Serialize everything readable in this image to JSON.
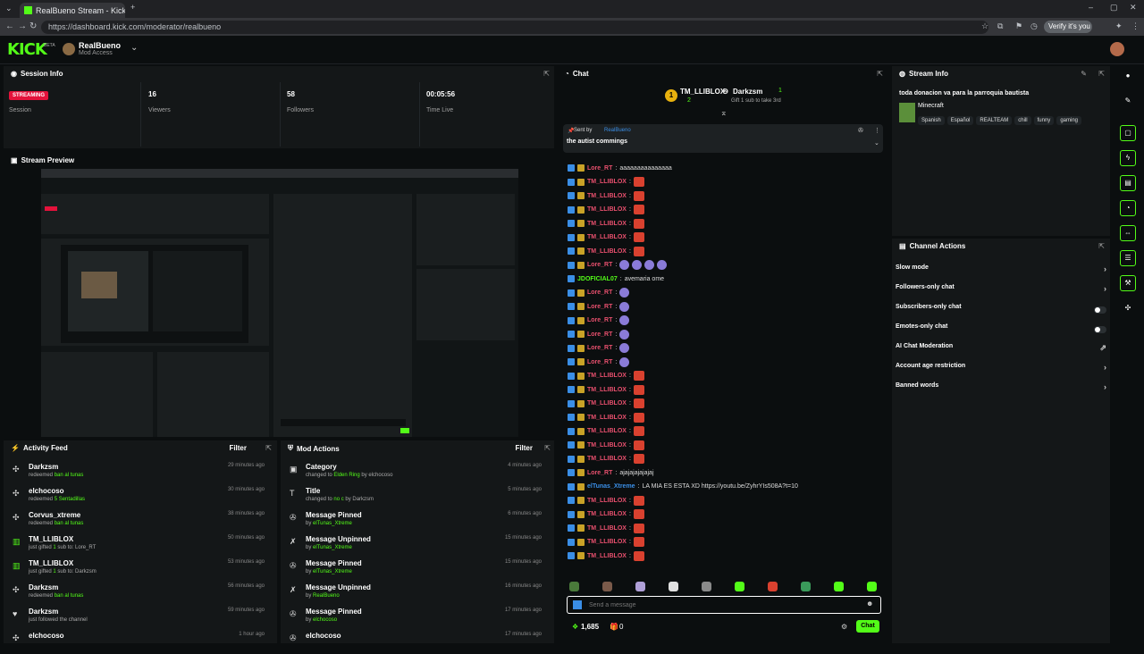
{
  "browser": {
    "tab_title": "RealBueno Stream - Kick Dashbo",
    "url": "https://dashboard.kick.com/moderator/realbueno",
    "verify_label": "Verify it's you"
  },
  "header": {
    "logo": "KICK",
    "logo_beta": "BETA",
    "channel_name": "RealBueno",
    "channel_role": "Mod Access"
  },
  "session_info": {
    "title": "Session Info",
    "status_badge": "STREAMING",
    "status_label": "Session",
    "viewers_value": "16",
    "viewers_label": "Viewers",
    "followers_value": "58",
    "followers_label": "Followers",
    "time_value": "00:05:56",
    "time_label": "Time Live"
  },
  "stream_preview": {
    "title": "Stream Preview"
  },
  "activity_feed": {
    "title": "Activity Feed",
    "filter": "Filter",
    "items": [
      {
        "name": "Darkzsm",
        "pre": "redeemed ",
        "hl": "ban al tunas",
        "post": "",
        "time": "29 minutes ago",
        "icon": "redeem"
      },
      {
        "name": "elchocoso",
        "pre": "redeemed ",
        "hl": "5 Sentadillas",
        "post": "",
        "time": "30 minutes ago",
        "icon": "redeem"
      },
      {
        "name": "Corvus_xtreme",
        "pre": "redeemed ",
        "hl": "ban al tunas",
        "post": "",
        "time": "38 minutes ago",
        "icon": "redeem"
      },
      {
        "name": "TM_LLIBLOX",
        "pre": "just gifted ",
        "hl": "1",
        "post": " sub to: Lore_RT",
        "time": "50 minutes ago",
        "icon": "gift"
      },
      {
        "name": "TM_LLIBLOX",
        "pre": "just gifted ",
        "hl": "1",
        "post": " sub to: Darkzsm",
        "time": "53 minutes ago",
        "icon": "gift"
      },
      {
        "name": "Darkzsm",
        "pre": "redeemed ",
        "hl": "ban al tunas",
        "post": "",
        "time": "56 minutes ago",
        "icon": "redeem"
      },
      {
        "name": "Darkzsm",
        "pre": "just followed the channel",
        "hl": "",
        "post": "",
        "time": "59 minutes ago",
        "icon": "heart"
      },
      {
        "name": "elchocoso",
        "pre": "",
        "hl": "",
        "post": "",
        "time": "1 hour ago",
        "icon": "redeem"
      }
    ]
  },
  "mod_actions": {
    "title": "Mod Actions",
    "filter": "Filter",
    "items": [
      {
        "name": "Category",
        "pre": "changed to ",
        "hl": "Elden Ring",
        "post": " by elchocoso",
        "time": "4 minutes ago",
        "icon": "category"
      },
      {
        "name": "Title",
        "pre": "changed to ",
        "hl": "no c",
        "post": " by Darkzsm",
        "time": "5 minutes ago",
        "icon": "title"
      },
      {
        "name": "Message Pinned",
        "pre": "by ",
        "hl": "elTunas_Xtreme",
        "post": "",
        "time": "6 minutes ago",
        "icon": "pin"
      },
      {
        "name": "Message Unpinned",
        "pre": "by ",
        "hl": "elTunas_Xtreme",
        "post": "",
        "time": "15 minutes ago",
        "icon": "unpin"
      },
      {
        "name": "Message Pinned",
        "pre": "by ",
        "hl": "elTunas_Xtreme",
        "post": "",
        "time": "15 minutes ago",
        "icon": "pin"
      },
      {
        "name": "Message Unpinned",
        "pre": "by ",
        "hl": "RealBueno",
        "post": "",
        "time": "16 minutes ago",
        "icon": "unpin"
      },
      {
        "name": "Message Pinned",
        "pre": "by ",
        "hl": "elchocoso",
        "post": "",
        "time": "17 minutes ago",
        "icon": "pin"
      },
      {
        "name": "elchocoso",
        "pre": "",
        "hl": "",
        "post": "",
        "time": "17 minutes ago",
        "icon": "pin"
      }
    ]
  },
  "chat": {
    "title": "Chat",
    "gift_leader_name": "TM_LLIBLOX",
    "gift_leader_count": "2",
    "gift_second_name": "Darkzsm",
    "gift_second_count": "1",
    "gift_hint": "Gift 1 sub to take 3rd",
    "pinned_sent_by": "Sent by",
    "pinned_author": "RealBueno",
    "pinned_text": "the autist commings",
    "messages": [
      {
        "user": "Lore_RT",
        "color": "#e8506e",
        "text": "aaaaaaaaaaaaaaa",
        "emotes": 0,
        "type": "none"
      },
      {
        "user": "TM_LLIBLOX",
        "color": "#e8506e",
        "text": "",
        "emotes": 1,
        "type": "red"
      },
      {
        "user": "TM_LLIBLOX",
        "color": "#e8506e",
        "text": "",
        "emotes": 1,
        "type": "red"
      },
      {
        "user": "TM_LLIBLOX",
        "color": "#e8506e",
        "text": "",
        "emotes": 1,
        "type": "red"
      },
      {
        "user": "TM_LLIBLOX",
        "color": "#e8506e",
        "text": "",
        "emotes": 1,
        "type": "red"
      },
      {
        "user": "TM_LLIBLOX",
        "color": "#e8506e",
        "text": "",
        "emotes": 1,
        "type": "red"
      },
      {
        "user": "TM_LLIBLOX",
        "color": "#e8506e",
        "text": "",
        "emotes": 1,
        "type": "red"
      },
      {
        "user": "Lore_RT",
        "color": "#e8506e",
        "text": "",
        "emotes": 4,
        "type": "purple"
      },
      {
        "user": "JDOFICIAL07",
        "color": "#53fc18",
        "text": "avemaria ome",
        "emotes": 0,
        "type": "none"
      },
      {
        "user": "Lore_RT",
        "color": "#e8506e",
        "text": "",
        "emotes": 1,
        "type": "purple"
      },
      {
        "user": "Lore_RT",
        "color": "#e8506e",
        "text": "",
        "emotes": 1,
        "type": "purple"
      },
      {
        "user": "Lore_RT",
        "color": "#e8506e",
        "text": "",
        "emotes": 1,
        "type": "purple"
      },
      {
        "user": "Lore_RT",
        "color": "#e8506e",
        "text": "",
        "emotes": 1,
        "type": "purple"
      },
      {
        "user": "Lore_RT",
        "color": "#e8506e",
        "text": "",
        "emotes": 1,
        "type": "purple"
      },
      {
        "user": "Lore_RT",
        "color": "#e8506e",
        "text": "",
        "emotes": 1,
        "type": "purple"
      },
      {
        "user": "TM_LLIBLOX",
        "color": "#e8506e",
        "text": "",
        "emotes": 1,
        "type": "red"
      },
      {
        "user": "TM_LLIBLOX",
        "color": "#e8506e",
        "text": "",
        "emotes": 1,
        "type": "red"
      },
      {
        "user": "TM_LLIBLOX",
        "color": "#e8506e",
        "text": "",
        "emotes": 1,
        "type": "red"
      },
      {
        "user": "TM_LLIBLOX",
        "color": "#e8506e",
        "text": "",
        "emotes": 1,
        "type": "red"
      },
      {
        "user": "TM_LLIBLOX",
        "color": "#e8506e",
        "text": "",
        "emotes": 1,
        "type": "red"
      },
      {
        "user": "TM_LLIBLOX",
        "color": "#e8506e",
        "text": "",
        "emotes": 1,
        "type": "red"
      },
      {
        "user": "TM_LLIBLOX",
        "color": "#e8506e",
        "text": "",
        "emotes": 1,
        "type": "red"
      },
      {
        "user": "Lore_RT",
        "color": "#e8506e",
        "text": "ajajajajajajaj",
        "emotes": 0,
        "type": "none"
      },
      {
        "user": "elTunas_Xtreme",
        "color": "#3a8ee6",
        "text": "LA MIA ES ESTA XD https://youtu.be/ZyhrYIs508A?t=10",
        "emotes": 0,
        "type": "none"
      },
      {
        "user": "TM_LLIBLOX",
        "color": "#e8506e",
        "text": "",
        "emotes": 1,
        "type": "red"
      },
      {
        "user": "TM_LLIBLOX",
        "color": "#e8506e",
        "text": "",
        "emotes": 1,
        "type": "red"
      },
      {
        "user": "TM_LLIBLOX",
        "color": "#e8506e",
        "text": "",
        "emotes": 1,
        "type": "red"
      },
      {
        "user": "TM_LLIBLOX",
        "color": "#e8506e",
        "text": "",
        "emotes": 1,
        "type": "red"
      },
      {
        "user": "TM_LLIBLOX",
        "color": "#e8506e",
        "text": "",
        "emotes": 1,
        "type": "red"
      }
    ],
    "input_placeholder": "Send a message",
    "points": "1,685",
    "gifts": "0",
    "send_label": "Chat"
  },
  "stream_info": {
    "title": "Stream Info",
    "stream_title": "toda donacion va para la parroquia bautista",
    "category": "Minecraft",
    "tags": [
      "Spanish",
      "Español",
      "REALTEAM",
      "chill",
      "funny",
      "gaming"
    ]
  },
  "channel_actions": {
    "title": "Channel Actions",
    "items": [
      {
        "label": "Slow mode",
        "control": "chevron"
      },
      {
        "label": "Followers-only chat",
        "control": "chevron"
      },
      {
        "label": "Subscribers-only chat",
        "control": "toggle"
      },
      {
        "label": "Emotes-only chat",
        "control": "toggle"
      },
      {
        "label": "AI Chat Moderation",
        "control": "external"
      },
      {
        "label": "Account age restriction",
        "control": "chevron"
      },
      {
        "label": "Banned words",
        "control": "chevron"
      }
    ]
  },
  "colors": {
    "accent": "#53fc18",
    "streaming": "#e4123b"
  }
}
